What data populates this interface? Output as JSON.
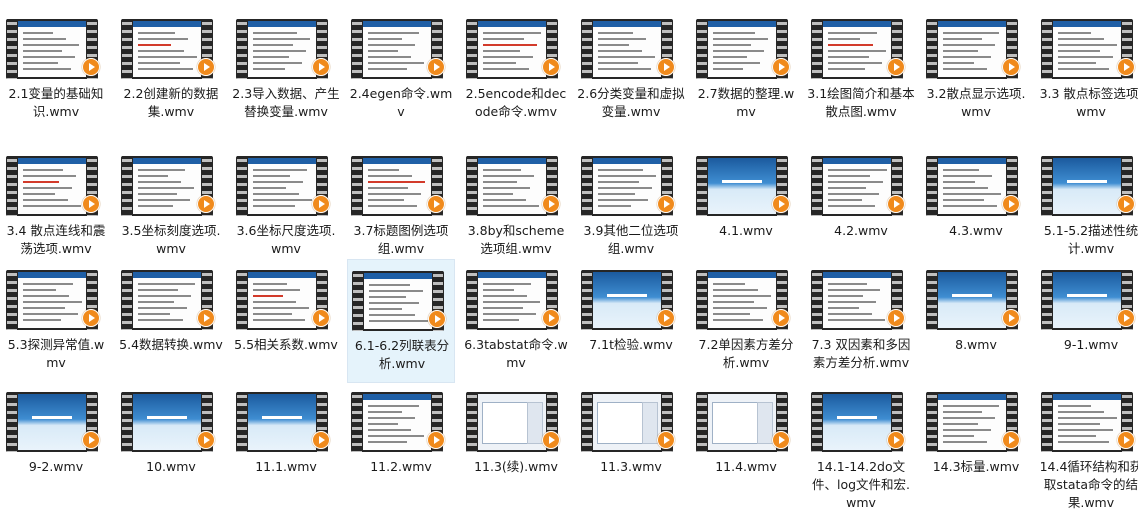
{
  "files": [
    {
      "name": "2.1变量的基础知识.wmv",
      "thumb": "doc"
    },
    {
      "name": "2.2创建新的数据集.wmv",
      "thumb": "doc"
    },
    {
      "name": "2.3导入数据、产生替换变量.wmv",
      "thumb": "doc"
    },
    {
      "name": "2.4egen命令.wmv",
      "thumb": "doc"
    },
    {
      "name": "2.5encode和decode命令.wmv",
      "thumb": "doc"
    },
    {
      "name": "2.6分类变量和虚拟变量.wmv",
      "thumb": "doc"
    },
    {
      "name": "2.7数据的整理.wmv",
      "thumb": "doc"
    },
    {
      "name": "3.1绘图简介和基本散点图.wmv",
      "thumb": "doc"
    },
    {
      "name": "3.2散点显示选项.wmv",
      "thumb": "doc"
    },
    {
      "name": "3.3 散点标签选项.wmv",
      "thumb": "doc"
    },
    {
      "name": "3.4 散点连线和震荡选项.wmv",
      "thumb": "doc"
    },
    {
      "name": "3.5坐标刻度选项.wmv",
      "thumb": "doc"
    },
    {
      "name": "3.6坐标尺度选项.wmv",
      "thumb": "doc"
    },
    {
      "name": "3.7标题图例选项组.wmv",
      "thumb": "doc"
    },
    {
      "name": "3.8by和scheme选项组.wmv",
      "thumb": "doc"
    },
    {
      "name": "3.9其他二位选项组.wmv",
      "thumb": "doc"
    },
    {
      "name": "4.1.wmv",
      "thumb": "ocean"
    },
    {
      "name": "4.2.wmv",
      "thumb": "doc"
    },
    {
      "name": "4.3.wmv",
      "thumb": "doc"
    },
    {
      "name": "5.1-5.2描述性统计.wmv",
      "thumb": "ocean"
    },
    {
      "name": "5.3探测异常值.wmv",
      "thumb": "doc"
    },
    {
      "name": "5.4数据转换.wmv",
      "thumb": "doc"
    },
    {
      "name": "5.5相关系数.wmv",
      "thumb": "doc"
    },
    {
      "name": "6.1-6.2列联表分析.wmv",
      "thumb": "doc",
      "selected": true
    },
    {
      "name": "6.3tabstat命令.wmv",
      "thumb": "doc"
    },
    {
      "name": "7.1t检验.wmv",
      "thumb": "ocean"
    },
    {
      "name": "7.2单因素方差分析.wmv",
      "thumb": "doc"
    },
    {
      "name": "7.3 双因素和多因素方差分析.wmv",
      "thumb": "doc"
    },
    {
      "name": "8.wmv",
      "thumb": "ocean"
    },
    {
      "name": "9-1.wmv",
      "thumb": "ocean"
    },
    {
      "name": "9-2.wmv",
      "thumb": "ocean"
    },
    {
      "name": "10.wmv",
      "thumb": "ocean"
    },
    {
      "name": "11.1.wmv",
      "thumb": "ocean"
    },
    {
      "name": "11.2.wmv",
      "thumb": "doc"
    },
    {
      "name": "11.3(续).wmv",
      "thumb": "screen"
    },
    {
      "name": "11.3.wmv",
      "thumb": "screen"
    },
    {
      "name": "11.4.wmv",
      "thumb": "screen"
    },
    {
      "name": "14.1-14.2do文件、log文件和宏.wmv",
      "thumb": "ocean"
    },
    {
      "name": "14.3标量.wmv",
      "thumb": "doc"
    },
    {
      "name": "14.4循环结构和获取stata命令的结果.wmv",
      "thumb": "doc"
    }
  ]
}
